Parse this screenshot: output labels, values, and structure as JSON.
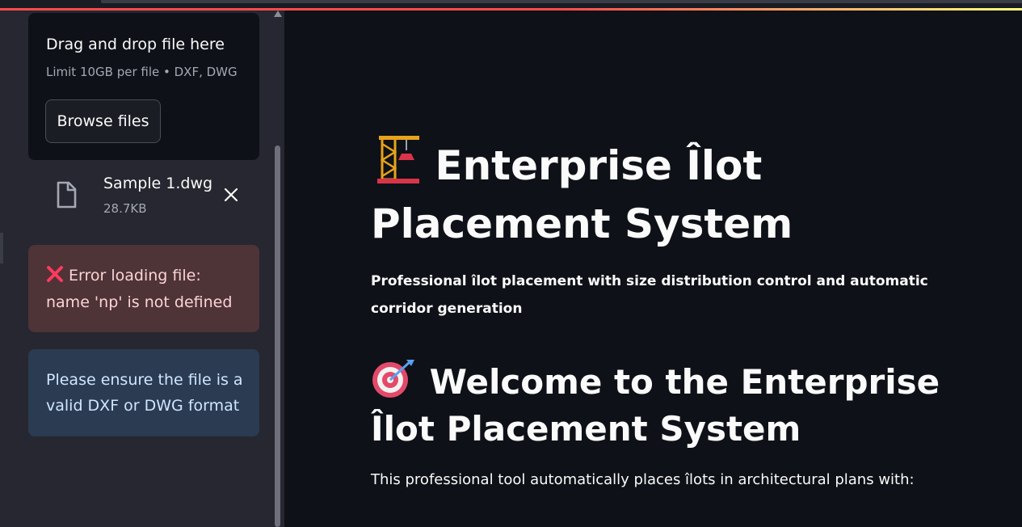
{
  "uploader": {
    "drop_title": "Drag and drop file here",
    "limit_text": "Limit 10GB per file • DXF, DWG",
    "browse_label": "Browse files"
  },
  "file": {
    "name": "Sample 1.dwg",
    "size": "28.7KB"
  },
  "alerts": {
    "error_text": "Error loading file: name 'np' is not defined",
    "info_text": "Please ensure the file is a valid DXF or DWG format"
  },
  "main": {
    "title": "Enterprise Îlot Placement System",
    "subtitle": "Professional îlot placement with size distribution control and automatic corridor generation",
    "welcome_heading": "Welcome to the Enterprise Îlot Placement System",
    "intro_text": "This professional tool automatically places îlots in architectural plans with:"
  },
  "icons": {
    "title_icon": "construction-crane-icon",
    "welcome_icon": "target-dart-icon",
    "file_icon": "file-icon",
    "error_icon": "red-x-icon"
  },
  "colors": {
    "accent": "#ff4b4b",
    "sidebar_bg": "#262730",
    "main_bg": "#0e1117",
    "error_bg": "#4e3337",
    "info_bg": "#2a3b52"
  }
}
